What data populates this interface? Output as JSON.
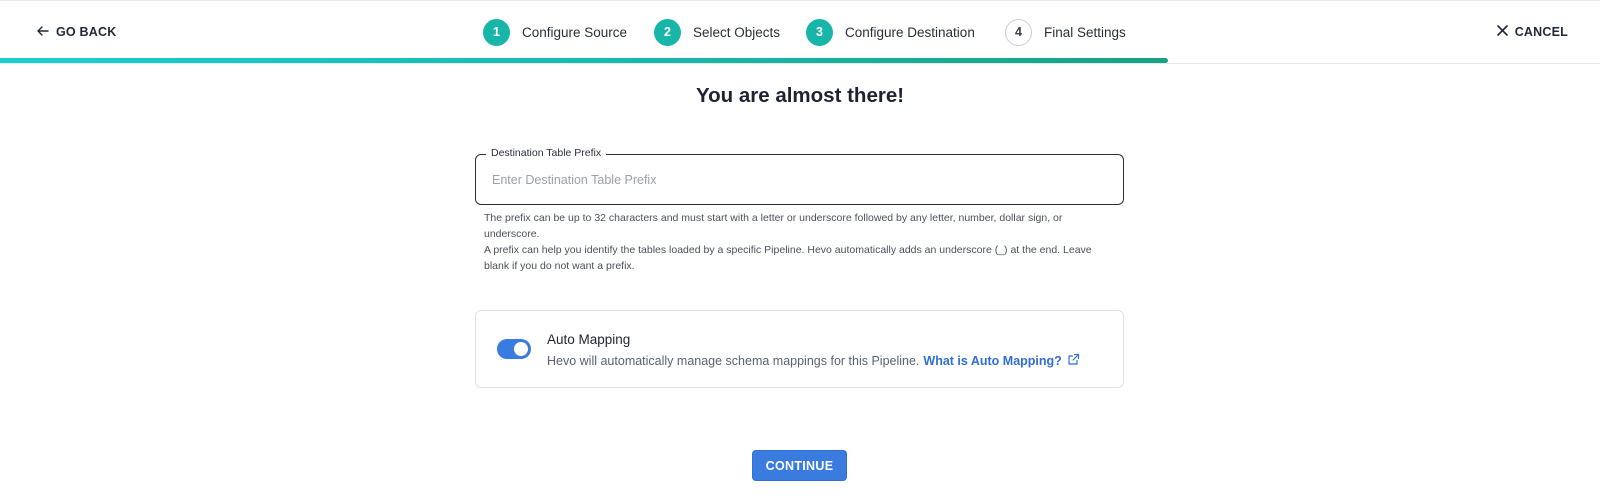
{
  "header": {
    "go_back_label": "GO BACK",
    "cancel_label": "CANCEL",
    "steps": [
      {
        "number": "1",
        "label": "Configure Source",
        "status": "completed"
      },
      {
        "number": "2",
        "label": "Select Objects",
        "status": "completed"
      },
      {
        "number": "3",
        "label": "Configure Destination",
        "status": "completed"
      },
      {
        "number": "4",
        "label": "Final Settings",
        "status": "pending"
      }
    ],
    "progress_fraction": 0.73
  },
  "main": {
    "title": "You are almost there!",
    "prefix_field": {
      "label": "Destination Table Prefix",
      "placeholder": "Enter Destination Table Prefix",
      "value": ""
    },
    "help_line1": "The prefix can be up to 32 characters and must start with a letter or underscore followed by any letter, number, dollar sign, or underscore.",
    "help_line2": "A prefix can help you identify the tables loaded by a specific Pipeline. Hevo automatically adds an underscore (_) at the end. Leave blank if you do not want a prefix.",
    "auto_mapping": {
      "title": "Auto Mapping",
      "description": "Hevo will automatically manage schema mappings for this Pipeline.",
      "link_label": "What is Auto Mapping?",
      "enabled": true
    },
    "continue_label": "CONTINUE"
  },
  "colors": {
    "accent_blue": "#3a7be0",
    "step_teal": "#17b6a8",
    "progress_start": "#19cfd4",
    "progress_end": "#15a383",
    "link_blue": "#2f6fd6"
  },
  "icons": {
    "back": "arrow-left-icon",
    "cancel": "close-icon",
    "external_link": "external-link-icon"
  }
}
